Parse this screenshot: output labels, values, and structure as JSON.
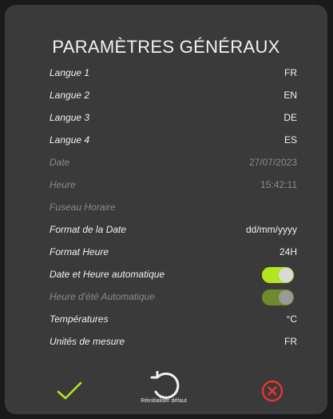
{
  "title": "PARAMÈTRES GÉNÉRAUX",
  "rows": [
    {
      "label": "Langue 1",
      "value": "FR"
    },
    {
      "label": "Langue 2",
      "value": "EN"
    },
    {
      "label": "Langue 3",
      "value": "DE"
    },
    {
      "label": "Langue 4",
      "value": "ES"
    },
    {
      "label": "Date",
      "value": "27/07/2023"
    },
    {
      "label": "Heure",
      "value": "15:42:11"
    },
    {
      "label": "Fuseau Horaire",
      "value": ""
    },
    {
      "label": "Format de la Date",
      "value": "dd/mm/yyyy"
    },
    {
      "label": "Format Heure",
      "value": "24H"
    },
    {
      "label": "Date et Heure automatique",
      "toggle_on": true
    },
    {
      "label": "Heure d'été Automatique",
      "toggle_on": true
    },
    {
      "label": "Températures",
      "value": "°C"
    },
    {
      "label": "Unités de mesure",
      "value": "FR"
    }
  ],
  "footer": {
    "confirm_icon": "check-icon",
    "reset_icon": "reset-icon",
    "reset_label": "Réinitialiser défaut",
    "cancel_icon": "cancel-icon"
  },
  "colors": {
    "accent_green": "#b5e61d",
    "cancel_red": "#e8333a",
    "panel": "#3a3a3a"
  }
}
